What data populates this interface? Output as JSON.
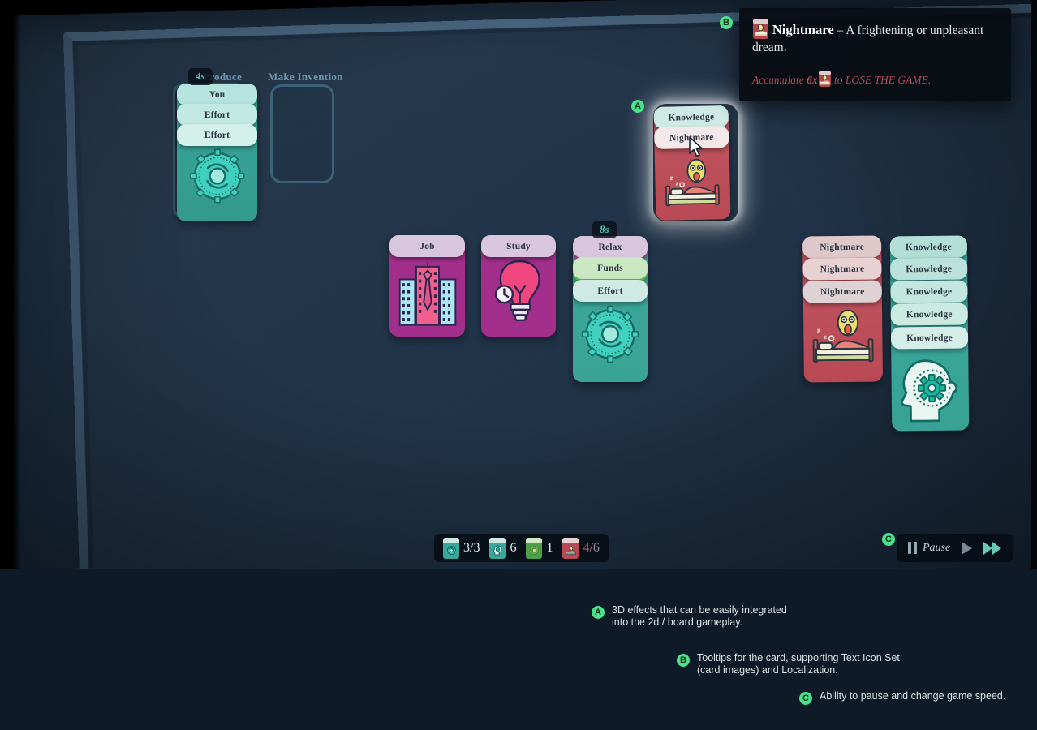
{
  "tooltip": {
    "name": "Nightmare",
    "separator": "–",
    "description": "A frightening or unpleasant dream.",
    "rule_prefix": "Accumulate",
    "rule_count": "6x",
    "rule_suffix": "to LOSE THE GAME.",
    "icon": "nightmare-card-icon"
  },
  "board": {
    "slots": [
      {
        "label": "Produce",
        "timer": "4s"
      },
      {
        "label": "Make Invention",
        "timer": ""
      }
    ],
    "produce_stack": {
      "cards": [
        "You",
        "Effort",
        "Effort"
      ],
      "base_art": "gear-cycle-icon",
      "base_color": "#3aa79c"
    },
    "hovered_stack": {
      "cards": [
        "Knowledge",
        "Nightmare"
      ],
      "base_art": "nightmare-bed-icon",
      "base_color": "#b94a55"
    },
    "center_cards": [
      {
        "label": "Job",
        "art": "office-buildings-icon",
        "color": "#a32f8c"
      },
      {
        "label": "Study",
        "art": "lightbulb-clock-icon",
        "color": "#a32f8c"
      }
    ],
    "relax_stack": {
      "timer": "8s",
      "cards": [
        "Relax",
        "Funds",
        "Effort"
      ],
      "base_art": "gear-cycle-icon"
    },
    "nightmare_stack": {
      "cards": [
        "Nightmare",
        "Nightmare",
        "Nightmare"
      ],
      "base_art": "nightmare-bed-icon",
      "base_color": "#b94a55"
    },
    "knowledge_stack": {
      "cards": [
        "Knowledge",
        "Knowledge",
        "Knowledge",
        "Knowledge",
        "Knowledge"
      ],
      "base_art": "head-gear-icon",
      "base_color": "#3aa79c"
    }
  },
  "resources": [
    {
      "name": "effort",
      "icon": "gear-card-icon",
      "value": "3/3",
      "danger": false
    },
    {
      "name": "knowledge",
      "icon": "head-card-icon",
      "value": "6",
      "danger": false
    },
    {
      "name": "funds",
      "icon": "funds-card-icon",
      "value": "1",
      "danger": false
    },
    {
      "name": "nightmare",
      "icon": "nightmare-card-icon",
      "value": "4",
      "max": "/6",
      "danger": true
    }
  ],
  "speed_controls": {
    "pause_label": "Pause",
    "play_icon": "play-icon",
    "fast_forward_icon": "fast-forward-icon"
  },
  "annotations": [
    {
      "letter": "A",
      "text_line1": "3D effects that can be easily integrated",
      "text_line2": "into the 2d / board gameplay."
    },
    {
      "letter": "B",
      "text_line1": "Tooltips for the card, supporting Text Icon Set",
      "text_line2": "(card images) and Localization."
    },
    {
      "letter": "C",
      "text_line1": "Ability to pause and change game speed.",
      "text_line2": ""
    }
  ],
  "colors": {
    "accent_teal": "#3aa79c",
    "accent_magenta": "#a32f8c",
    "danger_red": "#b94a55",
    "badge_green": "#4ce08a",
    "table": "#22354a"
  }
}
